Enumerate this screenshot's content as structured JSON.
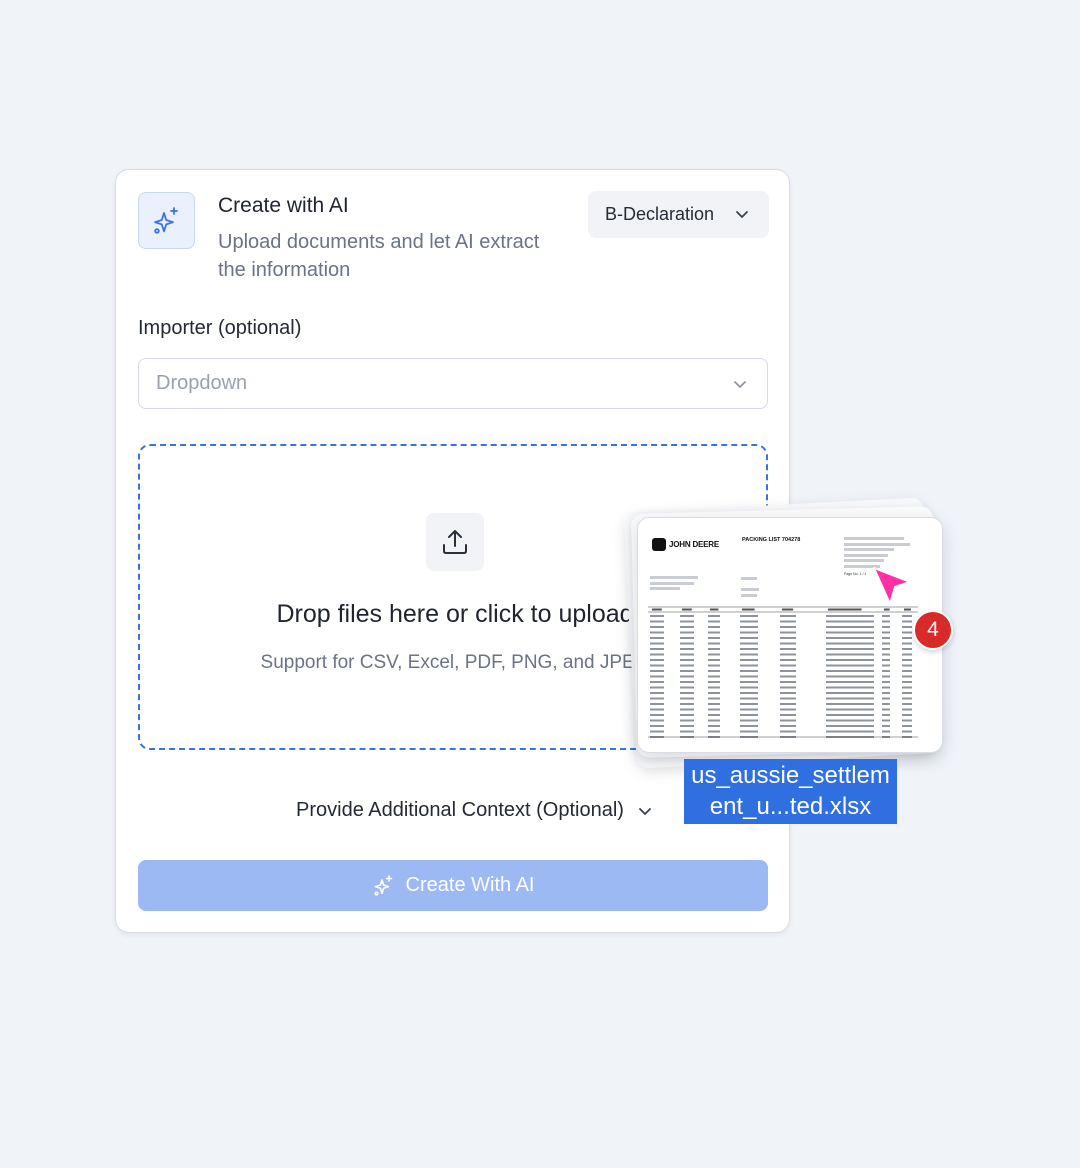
{
  "header": {
    "title": "Create with AI",
    "subtitle": "Upload documents and let AI extract the information",
    "declaration_type": "B-Declaration"
  },
  "importer": {
    "label": "Importer (optional)",
    "placeholder": "Dropdown"
  },
  "dropzone": {
    "title": "Drop files here or click to upload",
    "subtitle": "Support for CSV, Excel, PDF, PNG, and JPEG"
  },
  "context_toggle": {
    "label": "Provide Additional Context (Optional)"
  },
  "create_button": {
    "label": "Create With AI"
  },
  "drag_preview": {
    "file_name": "us_aussie_settlement_u...ted.xlsx",
    "file_count": "4",
    "document": {
      "brand": "JOHN DEERE",
      "heading": "PACKING LIST 704278",
      "page": "Page No. 1 / 1"
    }
  },
  "colors": {
    "accent": "#3a72e0",
    "button_disabled": "#9db9f3",
    "badge": "#d92a2a",
    "cursor": "#ff2fa8",
    "file_label_bg": "#2f6fe0"
  }
}
